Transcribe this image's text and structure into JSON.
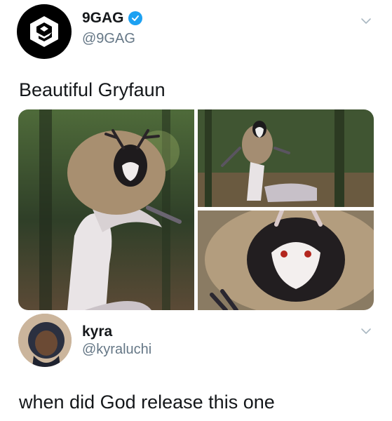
{
  "original_tweet": {
    "display_name": "9GAG",
    "handle": "@9GAG",
    "verified": true,
    "logo_icon": "9gag-logo-icon",
    "text": "Beautiful Gryfaun",
    "media": [
      {
        "icon": "creature-full-body-photo",
        "alt": "photo"
      },
      {
        "icon": "creature-forest-photo",
        "alt": "photo"
      },
      {
        "icon": "creature-face-closeup-photo",
        "alt": "photo"
      }
    ]
  },
  "reply_tweet": {
    "display_name": "kyra",
    "handle": "@kyraluchi",
    "text": "when did God release this one"
  },
  "colors": {
    "text": "#14171a",
    "secondary": "#657786",
    "verified": "#1da1f2",
    "chevron": "#aab8c2"
  }
}
